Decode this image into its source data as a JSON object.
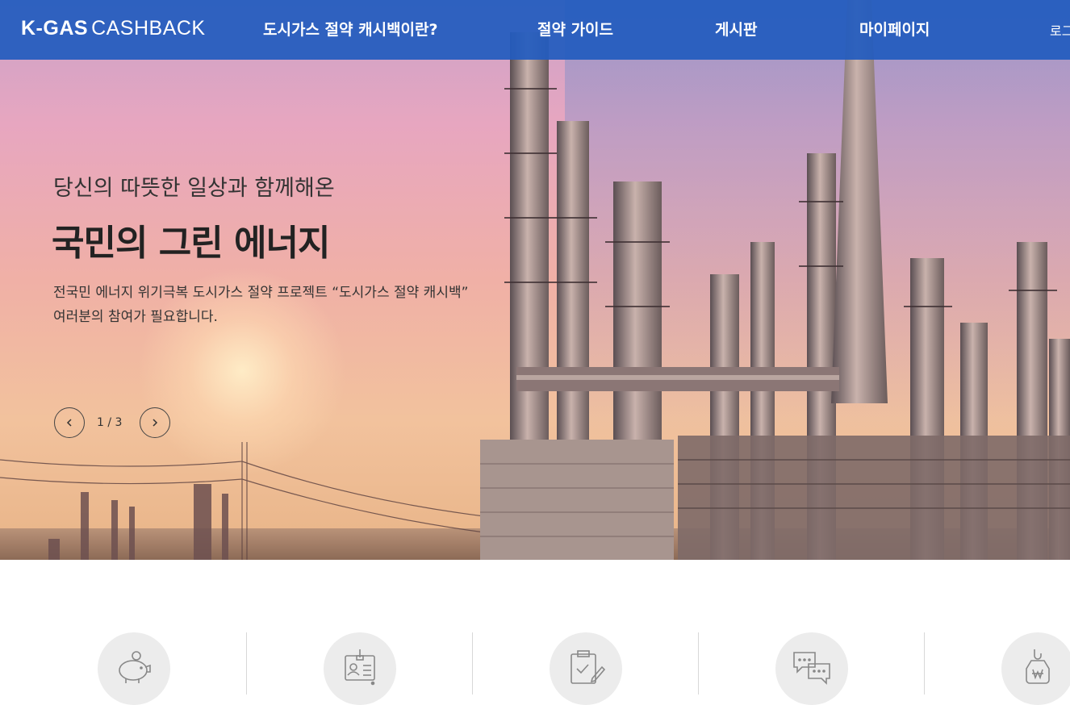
{
  "header": {
    "logo_bold": "K-GAS",
    "logo_light": "CASHBACK",
    "nav": [
      {
        "label": "도시가스 절약 캐시백이란?"
      },
      {
        "label": "절약 가이드"
      },
      {
        "label": "게시판"
      },
      {
        "label": "마이페이지"
      },
      {
        "label": "로그"
      }
    ]
  },
  "hero": {
    "subtitle": "당신의 따뜻한 일상과 함께해온",
    "title": "국민의 그린 에너지",
    "desc_line1": "전국민 에너지 위기극복 도시가스 절약 프로젝트 “도시가스 절약 캐시백”",
    "desc_line2": "여러분의 참여가 필요합니다.",
    "slide_counter": "1 / 3"
  },
  "features": [
    {
      "icon": "piggy-bank-icon"
    },
    {
      "icon": "id-card-icon"
    },
    {
      "icon": "clipboard-check-icon"
    },
    {
      "icon": "chat-bubbles-icon"
    },
    {
      "icon": "money-bag-icon"
    }
  ],
  "colors": {
    "header_bg": "#225BBE",
    "text_dark": "#222222",
    "icon_circle": "#ECECEC",
    "icon_stroke": "#888888"
  }
}
